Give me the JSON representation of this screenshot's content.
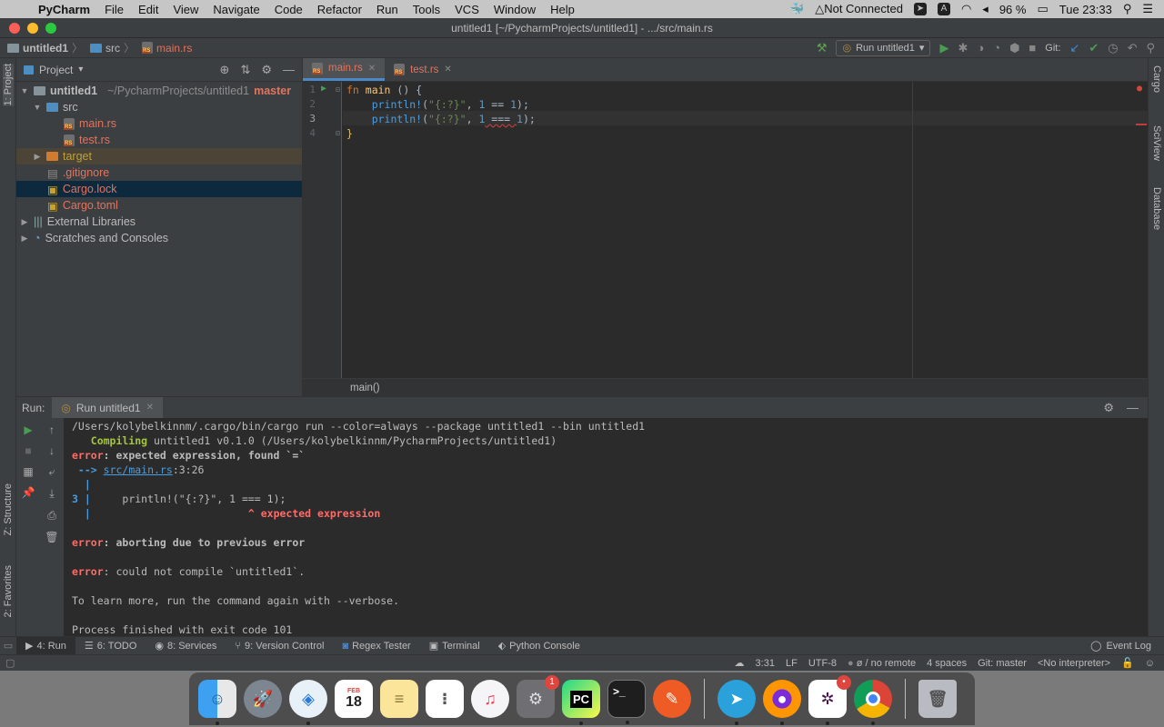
{
  "menubar": {
    "app_name": "PyCharm",
    "menus": [
      "File",
      "Edit",
      "View",
      "Navigate",
      "Code",
      "Refactor",
      "Run",
      "Tools",
      "VCS",
      "Window",
      "Help"
    ],
    "status_text": "Not Connected",
    "battery": "96 %",
    "clock": "Tue 23:33"
  },
  "window": {
    "title": "untitled1 [~/PycharmProjects/untitled1] - .../src/main.rs"
  },
  "navbar": {
    "crumbs": [
      "untitled1",
      "src",
      "main.rs"
    ],
    "run_config": "Run untitled1",
    "git_label": "Git:"
  },
  "left_strip": {
    "project_label": "1: Project",
    "structure_label": "Z: Structure",
    "favorites_label": "2: Favorites"
  },
  "right_strip": {
    "cargo_label": "Cargo",
    "sciview_label": "SciView",
    "database_label": "Database"
  },
  "project_panel": {
    "header": "Project",
    "tree": {
      "root_name": "untitled1",
      "root_path": "~/PycharmProjects/untitled1",
      "root_branch": "master",
      "src": "src",
      "main_rs": "main.rs",
      "test_rs": "test.rs",
      "target": "target",
      "gitignore": ".gitignore",
      "cargo_lock": "Cargo.lock",
      "cargo_toml": "Cargo.toml",
      "external_libraries": "External Libraries",
      "scratches": "Scratches and Consoles"
    }
  },
  "editor": {
    "tabs": [
      "main.rs",
      "test.rs"
    ],
    "line_numbers": [
      "1",
      "2",
      "3",
      "4"
    ],
    "line1": {
      "kw": "fn",
      "name": " main",
      "rest": " () {"
    },
    "line2": {
      "indent": "    ",
      "macro": "println!",
      "open": "(",
      "str": "\"{:?}\"",
      "mid": ", ",
      "a": "1",
      "op": " == ",
      "b": "1",
      "close": ");"
    },
    "line3": {
      "indent": "    ",
      "macro": "println!",
      "open": "(",
      "str": "\"{:?}\"",
      "mid": ", ",
      "a": "1",
      "op": " === ",
      "b": "1",
      "close": ");"
    },
    "line4": "}",
    "breadcrumb": "main()"
  },
  "run_panel": {
    "label": "Run:",
    "tab": "Run untitled1",
    "console": {
      "l1": "/Users/kolybelkinnm/.cargo/bin/cargo run --color=always --package untitled1 --bin untitled1",
      "l2_kw": "   Compiling",
      "l2_rest": " untitled1 v0.1.0 (/Users/kolybelkinnm/PycharmProjects/untitled1)",
      "l3_kw": "error",
      "l3_rest": ": expected expression, found `=`",
      "l4_arrow": " -->",
      "l4_link": "src/main.rs",
      "l4_rest": ":3:26",
      "l5": "  |",
      "l6_num": "3 |",
      "l6_rest": "     println!(\"{:?}\", 1 === 1);",
      "l7_bar": "  |",
      "l7_rest": "                         ^ expected expression",
      "l8_kw": "error",
      "l8_rest": ": aborting due to previous error",
      "l9_kw": "error",
      "l9_rest": ": could not compile `untitled1`.",
      "l10": "To learn more, run the command again with --verbose.",
      "l11": "Process finished with exit code 101"
    }
  },
  "tool_windows": {
    "run": "4: Run",
    "todo": "6: TODO",
    "services": "8: Services",
    "version_control": "9: Version Control",
    "regex": "Regex Tester",
    "terminal": "Terminal",
    "python_console": "Python Console",
    "event_log": "Event Log"
  },
  "statusbar": {
    "position": "3:31",
    "line_sep": "LF",
    "encoding": "UTF-8",
    "remote": "ø / no remote",
    "indent": "4 spaces",
    "git": "Git: master",
    "interpreter": "<No interpreter>"
  },
  "dock": {
    "items": [
      "finder",
      "launchpad",
      "safari",
      "calendar",
      "notes",
      "reminders",
      "music",
      "system-preferences",
      "pycharm",
      "terminal",
      "postman",
      "telegram",
      "firefox",
      "slack",
      "chrome",
      "trash"
    ],
    "calendar_month": "FEB",
    "calendar_day": "18",
    "badge_prefs": "1"
  },
  "colors": {
    "editor_bg": "#2b2b2b",
    "panel_bg": "#3c3f41",
    "accent_red": "#e0745f",
    "error_red": "#ff6b68",
    "link_blue": "#4a9ee0",
    "compiling_green": "#a4c639"
  }
}
